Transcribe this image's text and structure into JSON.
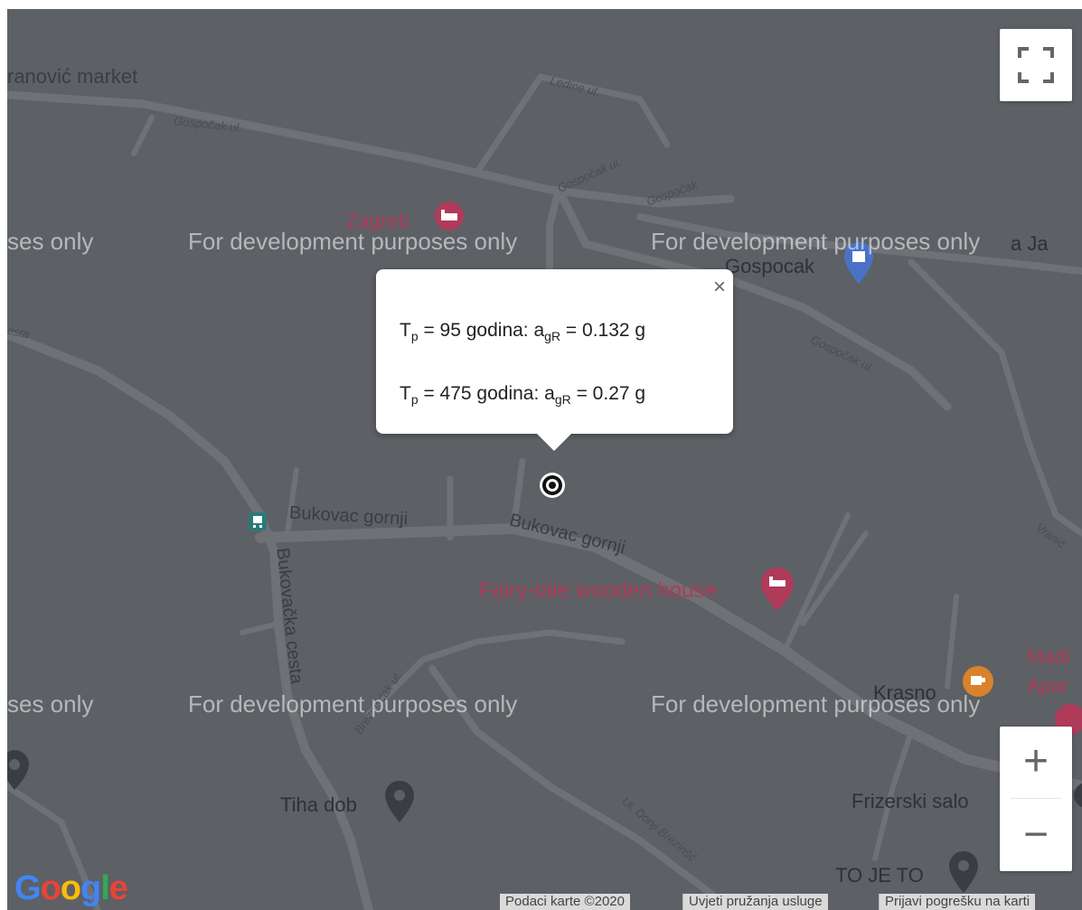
{
  "watermark": "For development purposes only",
  "watermark_left": "ses only",
  "roads": {
    "gospocak_ul_1": "Gospočak ul.",
    "gospocak_ul_2": "Gospočak ul.",
    "gospocak": "Gospočak",
    "gospocak_ul_3": "Gospočak ul.",
    "ledine_ul": "Ledine ul.",
    "cesta": "esta",
    "bukovac_gornji_1": "Bukovac gornji",
    "bukovac_gornji_2": "Bukovac gornji",
    "bukovacka": "Bukovačka cesta",
    "brezinscak_ul": "Brezinšćak ul.",
    "donji_brezinscak": "Ul. Donji Brezinšć",
    "vranic": "Vranić"
  },
  "places": {
    "market": "ranović market",
    "zagreb": "Zagreb",
    "gospocak_poi": "Gospocak",
    "ja": "a Ja",
    "fairy_tale": "Fairy-tale wooden house",
    "krasno": "Krasno",
    "madi": "Madi",
    "apar": "Apar",
    "tiha_dob": "Tiha dob",
    "frizerski": "Frizerski salo",
    "to_je_to": "TO JE TO"
  },
  "popup": {
    "row1": {
      "t": "T",
      "t_sub": "p",
      "mid": " =  95 godina: a",
      "a_sub": "gR",
      "end": " = 0.132 g"
    },
    "row2": {
      "t": "T",
      "t_sub": "p",
      "mid": " = 475 godina: a",
      "a_sub": "gR",
      "end": " = 0.27 g"
    },
    "close": "×"
  },
  "controls": {
    "zoom_in": "+",
    "zoom_out": "−"
  },
  "attribution": {
    "map_data": "Podaci karte ©2020",
    "terms": "Uvjeti pružanja usluge",
    "report": "Prijavi pogrešku na karti"
  },
  "logo": "Google",
  "colors": {
    "map_bg": "#5d6065",
    "road": "#6e7176",
    "poi_pink": "#b03a5a",
    "poi_orange": "#d9822b",
    "poi_blue": "#4a72c4"
  }
}
